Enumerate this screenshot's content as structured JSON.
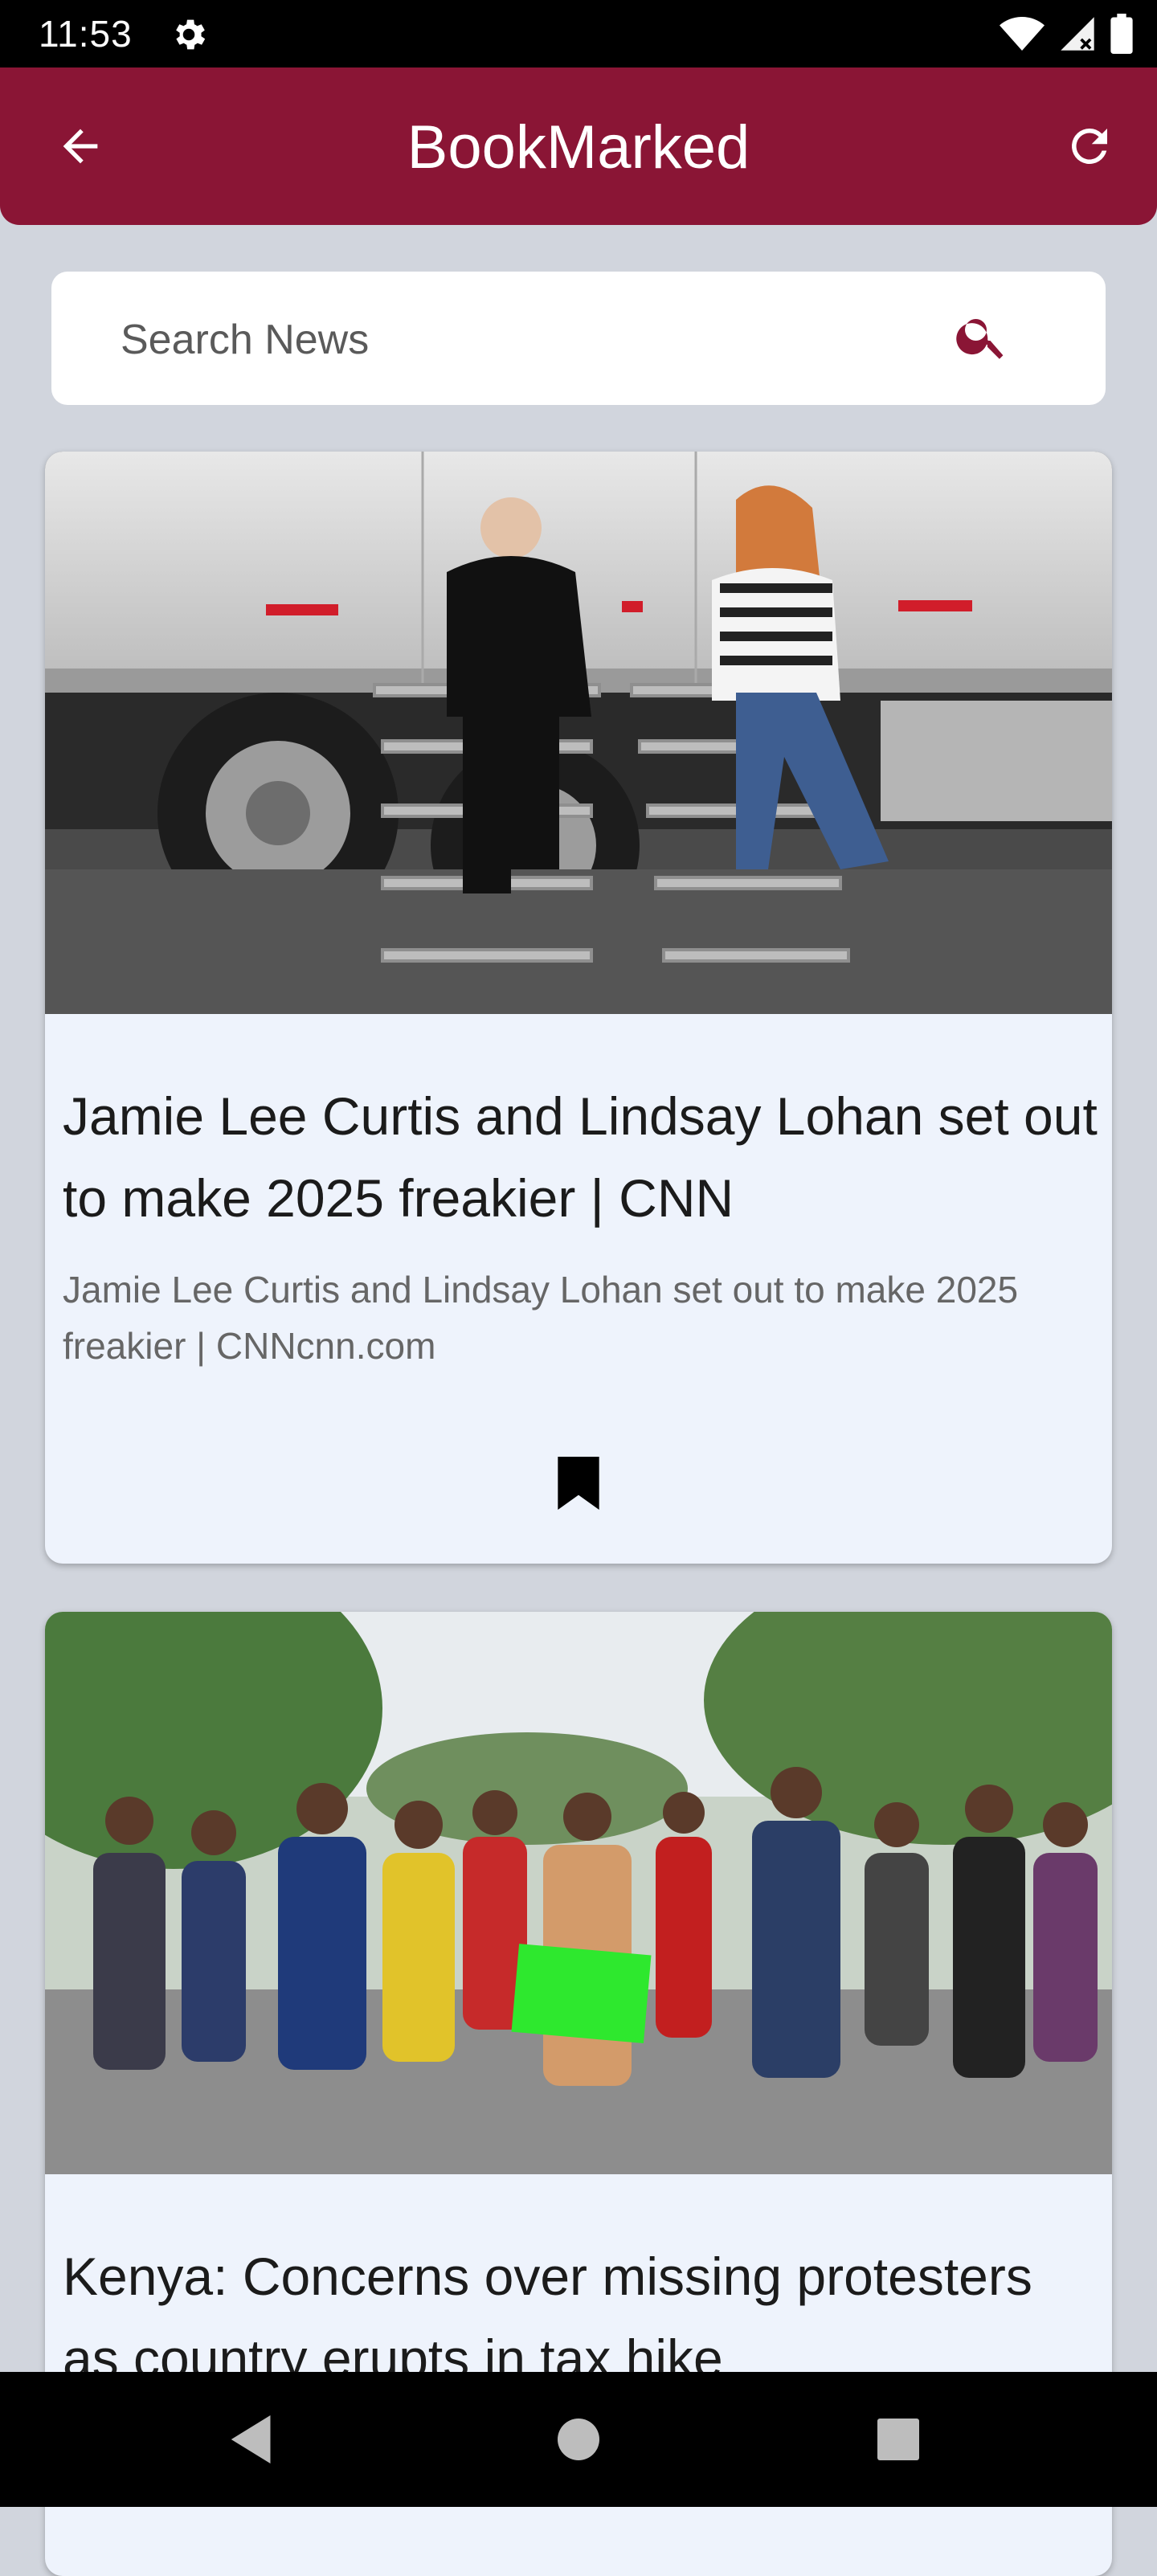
{
  "status_bar": {
    "time": "11:53",
    "icons": [
      "gear-icon",
      "wifi-icon",
      "signal-icon",
      "battery-icon"
    ]
  },
  "app_bar": {
    "title": "BookMarked",
    "back_icon": "arrow-back-icon",
    "refresh_icon": "refresh-icon",
    "background_color": "#8a1535"
  },
  "search": {
    "placeholder": "Search News",
    "icon": "search-icon",
    "icon_color": "#8a1535"
  },
  "articles": [
    {
      "title": "Jamie Lee Curtis and Lindsay Lohan set out to make 2025 freakier | CNN",
      "description": "Jamie Lee Curtis and Lindsay Lohan set out to make 2025 freakier | CNNcnn.com",
      "bookmarked": true
    },
    {
      "title": "Kenya: Concerns over missing protesters as country erupts in tax hike"
    }
  ],
  "nav_bar": {
    "icons": [
      "nav-back-icon",
      "nav-home-icon",
      "nav-recents-icon"
    ]
  }
}
